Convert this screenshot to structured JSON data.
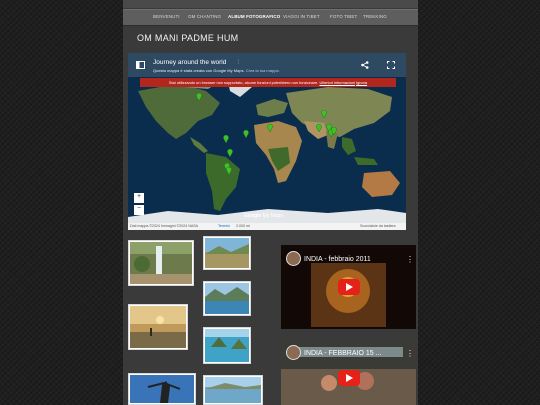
{
  "nav": {
    "items": [
      "BENVENUTI",
      "OM CHANTING",
      "ALBUM FOTOGRAFICO",
      "VIAGGI IN TIBET",
      "FOTO TIBET",
      "TREKKING"
    ],
    "active_index": 2
  },
  "site_title": "OM MANI PADME HUM",
  "map": {
    "title": "Journey around the world",
    "subtitle": "Questa mappa è stata creata con Google My Maps.",
    "subtitle_link": "Crea la tua mappa.",
    "warning": "Stai utilizzando un browser non supportato, alcune funzioni potrebbero non funzionare.",
    "warning_link": "Ulteriori informazioni",
    "warning_close": "Ignora",
    "google_label": "Google",
    "mymaps_label": "My Maps",
    "attribution": "Dati mappa ©2024 Immagini ©2024 NASA",
    "terms": "Termini",
    "scale": "2.000 mi",
    "shortcuts": "Scorciatoie da tastiera",
    "zoom_in": "+",
    "zoom_out": "−",
    "accent_color": "#b1271d",
    "marker_color": "#3fbf2a"
  },
  "videos": [
    {
      "title": "INDIA - febbraio 2011"
    },
    {
      "title": "INDIA - FEBBRAIO 15 ..."
    }
  ],
  "colors": {
    "page_bg": "#3a3a3a",
    "nav_bg": "#5e5e5e",
    "youtube_red": "#e62117"
  }
}
